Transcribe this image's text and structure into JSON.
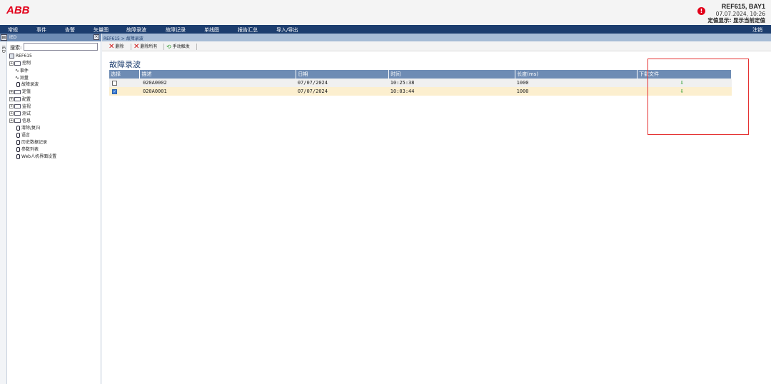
{
  "header": {
    "logo": "ABB",
    "device": "REF615, BAY1",
    "datetime": "07.07.2024, 10:26",
    "setting_display": "定值显示: 显示当前定值"
  },
  "menu": {
    "items": [
      "常规",
      "事件",
      "告警",
      "矢量图",
      "故障录波",
      "故障记录",
      "单线图",
      "报告汇总",
      "导入/导出"
    ],
    "logout": "注销"
  },
  "sidebar": {
    "title": "IED",
    "vtab": "IED",
    "search_label": "搜索:",
    "search_value": "",
    "tree": [
      {
        "label": "REF615",
        "kind": "root"
      },
      {
        "label": "控制",
        "kind": "folder"
      },
      {
        "label": "事件",
        "kind": "wave"
      },
      {
        "label": "测量",
        "kind": "wave"
      },
      {
        "label": "故障录波",
        "kind": "leaf"
      },
      {
        "label": "定值",
        "kind": "folder"
      },
      {
        "label": "配置",
        "kind": "folder"
      },
      {
        "label": "监视",
        "kind": "folder"
      },
      {
        "label": "测试",
        "kind": "folder"
      },
      {
        "label": "信息",
        "kind": "folder"
      },
      {
        "label": "清除/复归",
        "kind": "leaf"
      },
      {
        "label": "语言",
        "kind": "leaf"
      },
      {
        "label": "历史数据记录",
        "kind": "leaf"
      },
      {
        "label": "参数列表",
        "kind": "leaf"
      },
      {
        "label": "Web人机界面设置",
        "kind": "leaf"
      }
    ]
  },
  "main": {
    "breadcrumb": "REF615 > 故障录波",
    "toolbar": {
      "delete": "删除",
      "delete_all": "删除所有",
      "manual_trigger": "手动触发"
    },
    "title": "故障录波",
    "columns": [
      "选择",
      "描述",
      "日期",
      "时间",
      "长度(ms)",
      "下载文件"
    ],
    "rows": [
      {
        "selected": false,
        "desc": "020A0002",
        "date": "07/07/2024",
        "time": "10:25:38",
        "length": "1000"
      },
      {
        "selected": true,
        "desc": "020A0001",
        "date": "07/07/2024",
        "time": "10:03:44",
        "length": "1000"
      }
    ]
  },
  "colors": {
    "menu_bg": "#1c3d6e",
    "header_bar": "#6e8cb4",
    "highlight": "#e53232",
    "selected_row": "#fcefcf"
  }
}
